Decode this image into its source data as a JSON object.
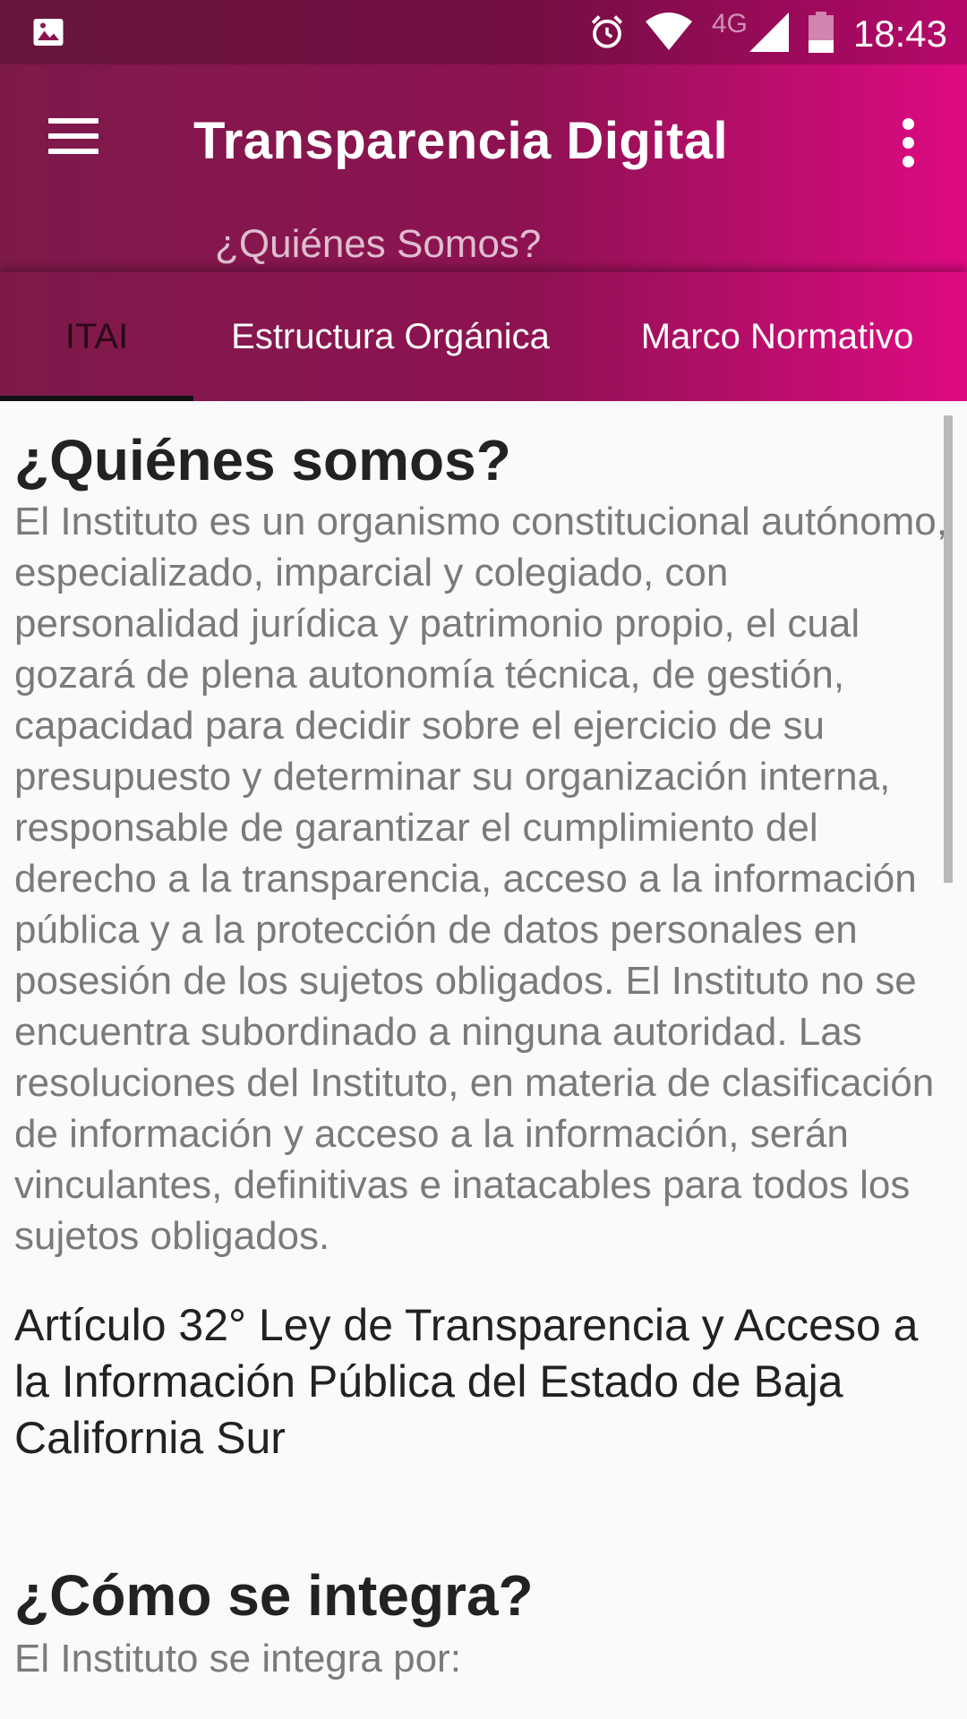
{
  "status_bar": {
    "time": "18:43",
    "network": "4G",
    "icons": [
      "image-icon",
      "alarm-icon",
      "wifi-icon",
      "signal-icon",
      "battery-icon"
    ]
  },
  "app_bar": {
    "title": "Transparencia Digital",
    "subtitle": "¿Quiénes Somos?",
    "icons": [
      "menu-icon",
      "overflow-menu-icon"
    ]
  },
  "tabs": [
    {
      "label": "ITAI",
      "selected": true
    },
    {
      "label": "Estructura Orgánica",
      "selected": false
    },
    {
      "label": "Marco Normativo",
      "selected": false
    }
  ],
  "content": {
    "section1_title": "¿Quiénes somos?",
    "section1_body": "El Instituto es un organismo constitucional autónomo, especializado, imparcial y colegiado, con personalidad jurídica y patrimonio propio, el cual gozará de plena autonomía técnica, de gestión, capacidad para decidir sobre el ejercicio de su presupuesto y determinar su organización interna, responsable de garantizar el cumplimiento del derecho a la transparencia, acceso a la información pública y a la protección de datos personales en posesión de los sujetos obligados. El Instituto no se encuentra subordinado a ninguna autoridad. Las resoluciones del Instituto, en materia de clasificación de información y acceso a la información, serán vinculantes, definitivas e inatacables para todos los sujetos obligados.",
    "article_ref": "Artículo 32° Ley de Transparencia y Acceso a la Información Pública del Estado de Baja California Sur",
    "section2_title": "¿Cómo se integra?",
    "section2_intro": "El Instituto se integra por:"
  },
  "colors": {
    "header_gradient_start": "#7e1a4a",
    "header_gradient_end": "#de0a82",
    "tab_indicator": "#111111",
    "body_text": "#7a7a7a",
    "heading_text": "#222222"
  }
}
